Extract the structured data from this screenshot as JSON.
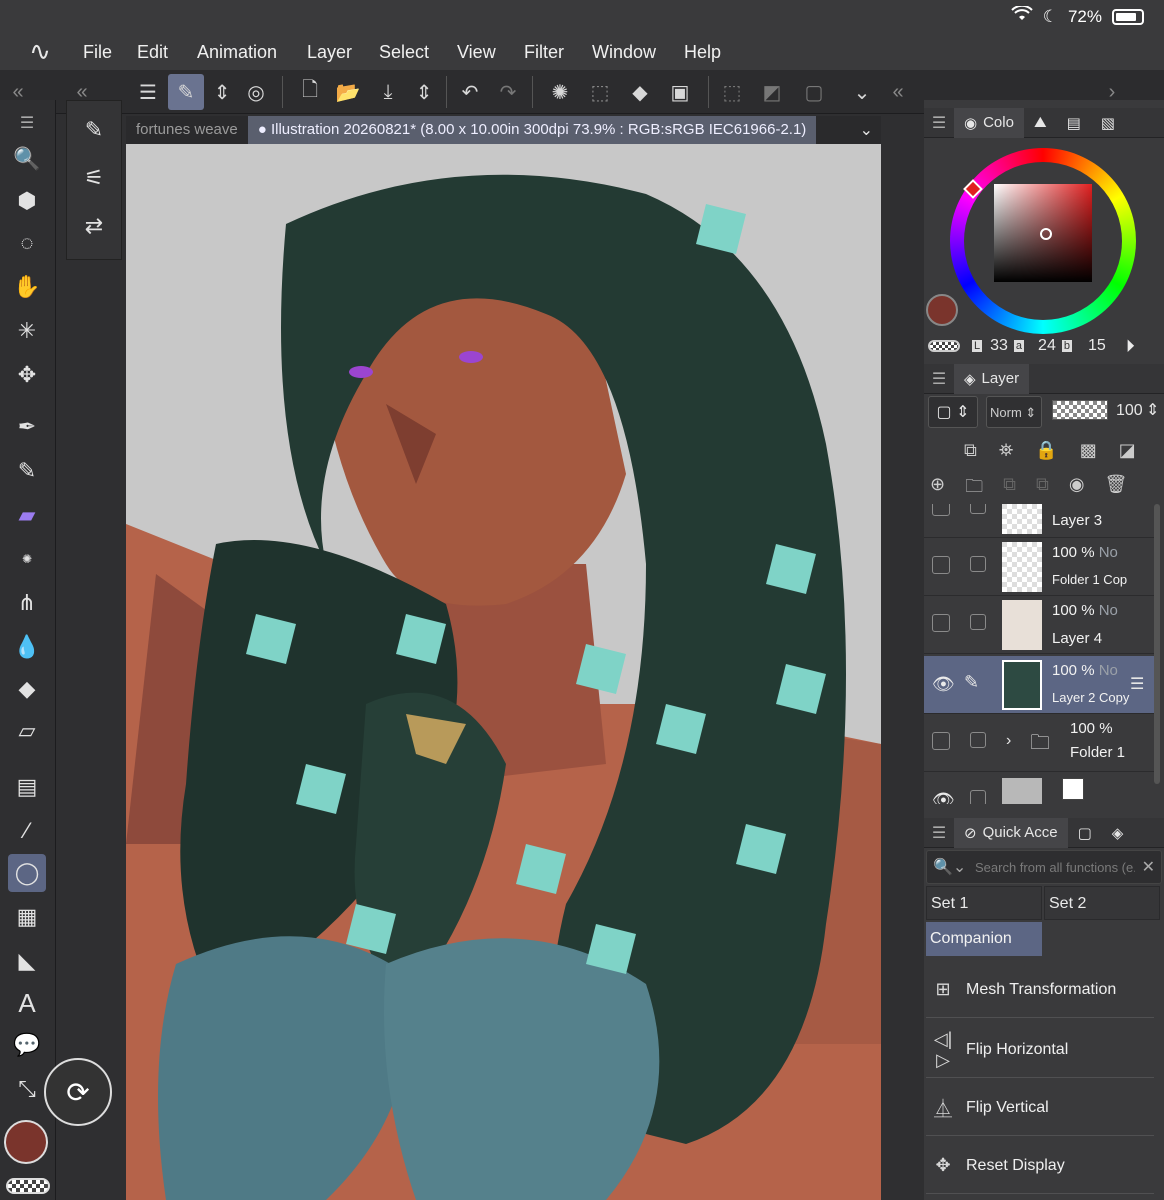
{
  "status": {
    "battery": "72%"
  },
  "menu": [
    "File",
    "Edit",
    "Animation",
    "Layer",
    "Select",
    "View",
    "Filter",
    "Window",
    "Help"
  ],
  "doc_tabs": {
    "inactive": "fortunes weave",
    "active": "Illustration 20260821* (8.00 x 10.00in 300dpi 73.9% : RGB:sRGB IEC61966-2.1)"
  },
  "color_panel": {
    "tab_label": "Colo",
    "lab": {
      "L_label": "L",
      "L": "33",
      "a_label": "a",
      "a": "24",
      "b_label": "b",
      "b": "15"
    },
    "main_color": "#7a342c"
  },
  "layer_panel": {
    "tab_label": "Layer",
    "blend_mode": "Norm",
    "opacity": "100",
    "layers": [
      {
        "name": "Layer 3",
        "opacity": "",
        "mode": ""
      },
      {
        "name": "Folder 1 Cop",
        "opacity": "100 %",
        "mode": "No"
      },
      {
        "name": "Layer 4",
        "opacity": "100 %",
        "mode": "No"
      },
      {
        "name": "Layer 2 Copy",
        "opacity": "100 %",
        "mode": "No"
      },
      {
        "name": "Folder 1",
        "opacity": "100 %",
        "mode": ""
      }
    ]
  },
  "quick_access": {
    "tab_label": "Quick Acce",
    "search_placeholder": "Search from all functions (e.g. tr",
    "set1": "Set 1",
    "set2": "Set 2",
    "companion": "Companion",
    "items": [
      "Mesh Transformation",
      "Flip Horizontal",
      "Flip Vertical",
      "Reset Display"
    ]
  }
}
